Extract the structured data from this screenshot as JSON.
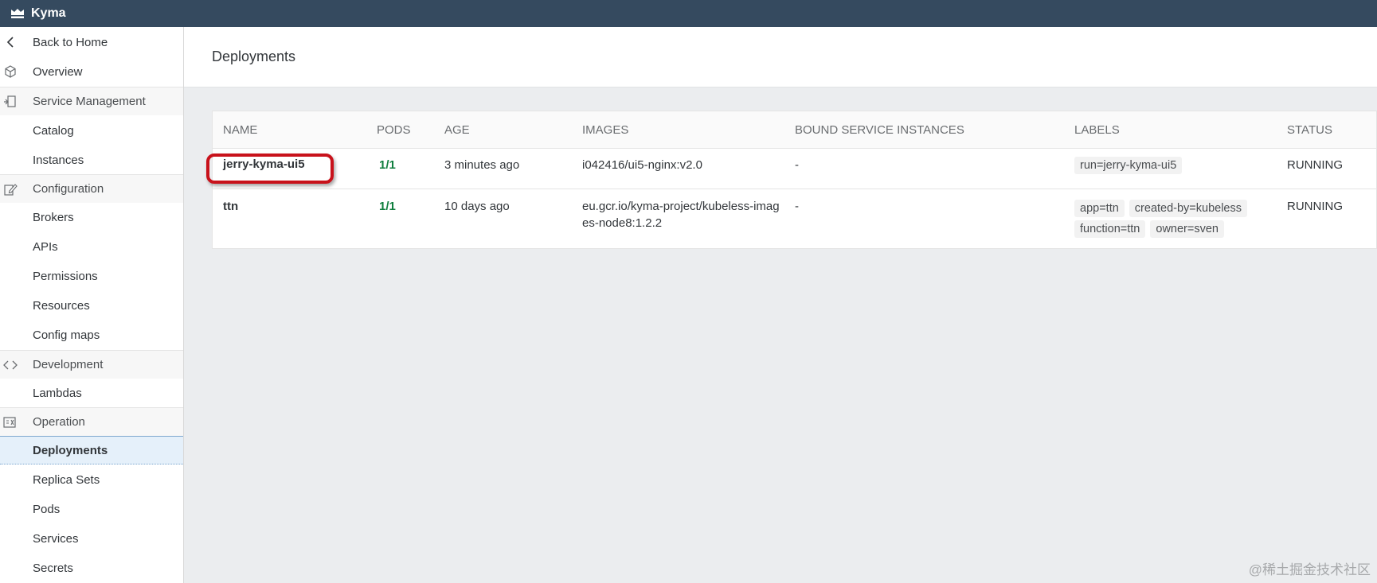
{
  "app": {
    "title": "Kyma"
  },
  "sidebar": {
    "back": "Back to Home",
    "overview": "Overview",
    "sections": [
      {
        "label": "Service Management",
        "icon": "service-icon",
        "items": [
          "Catalog",
          "Instances"
        ]
      },
      {
        "label": "Configuration",
        "icon": "edit-icon",
        "items": [
          "Brokers",
          "APIs",
          "Permissions",
          "Resources",
          "Config maps"
        ]
      },
      {
        "label": "Development",
        "icon": "code-icon",
        "items": [
          "Lambdas"
        ]
      },
      {
        "label": "Operation",
        "icon": "operation-icon",
        "items": [
          "Deployments",
          "Replica Sets",
          "Pods",
          "Services",
          "Secrets"
        ]
      }
    ],
    "active_item": "Deployments"
  },
  "page": {
    "title": "Deployments"
  },
  "table": {
    "columns": [
      "NAME",
      "PODS",
      "AGE",
      "IMAGES",
      "BOUND SERVICE INSTANCES",
      "LABELS",
      "STATUS"
    ],
    "rows": [
      {
        "name": "jerry-kyma-ui5",
        "pods": "1/1",
        "age": "3 minutes ago",
        "images": "i042416/ui5-nginx:v2.0",
        "bound": "-",
        "labels": [
          "run=jerry-kyma-ui5"
        ],
        "status": "RUNNING"
      },
      {
        "name": "ttn",
        "pods": "1/1",
        "age": "10 days ago",
        "images": "eu.gcr.io/kyma-project/kubeless-images-node8:1.2.2",
        "bound": "-",
        "labels": [
          "app=ttn",
          "created-by=kubeless",
          "function=ttn",
          "owner=sven"
        ],
        "status": "RUNNING"
      }
    ]
  },
  "watermark": "@稀土掘金技术社区",
  "colors": {
    "topbar": "#354a5f",
    "pods_ok": "#107e3e",
    "highlight": "#c8121b",
    "active_bg": "#e5f0fa"
  }
}
